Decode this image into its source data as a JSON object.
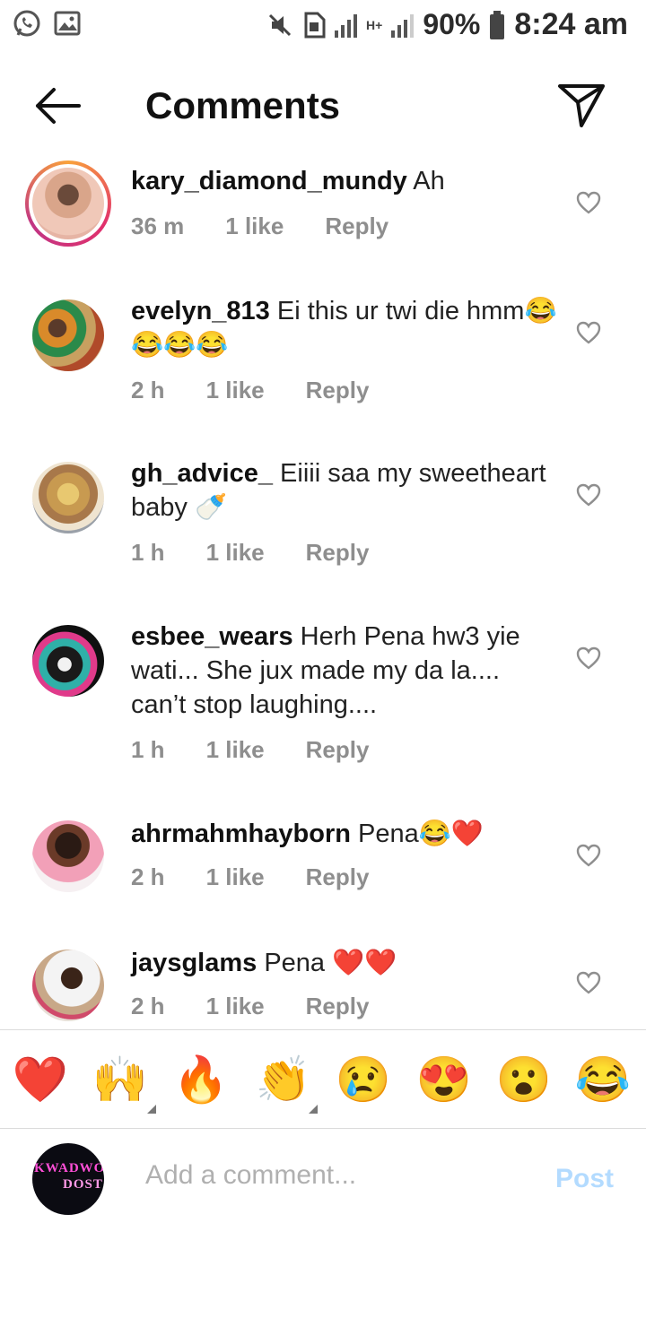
{
  "status_bar": {
    "battery_percent": "90%",
    "time": "8:24 am",
    "network_label": "H+"
  },
  "header": {
    "title": "Comments"
  },
  "comments": [
    {
      "username": "kary_diamond_mundy",
      "text": "Ah",
      "time": "36 m",
      "likes": "1 like",
      "reply": "Reply"
    },
    {
      "username": "evelyn_813",
      "text": "Ei this ur twi die hmm😂😂😂😂",
      "time": "2 h",
      "likes": "1 like",
      "reply": "Reply"
    },
    {
      "username": "gh_advice_",
      "text": "Eiiii saa my sweetheart baby 🍼",
      "time": "1 h",
      "likes": "1 like",
      "reply": "Reply"
    },
    {
      "username": "esbee_wears",
      "text": "Herh Pena hw3 yie wati... She jux made my da la.... can’t stop laughing....",
      "time": "1 h",
      "likes": "1 like",
      "reply": "Reply"
    },
    {
      "username": "ahrmahmhayborn",
      "text": "Pena😂❤️",
      "time": "2 h",
      "likes": "1 like",
      "reply": "Reply"
    },
    {
      "username": "jaysglams",
      "text": "Pena ❤️❤️",
      "time": "2 h",
      "likes": "1 like",
      "reply": "Reply"
    }
  ],
  "emoji_bar": [
    "❤️",
    "🙌",
    "🔥",
    "👏",
    "😢",
    "😍",
    "😮",
    "😂"
  ],
  "composer": {
    "avatar_text_1": "KWADWO",
    "avatar_text_2": "DOST",
    "placeholder": "Add a comment...",
    "post_label": "Post"
  },
  "colors": {
    "accent_disabled": "#b3dbff",
    "meta_gray": "#8e8e8e",
    "story_ring": "#e1306c"
  },
  "icons": {
    "back": "arrow-left-icon",
    "share": "paper-plane-icon",
    "like": "heart-outline-icon"
  }
}
